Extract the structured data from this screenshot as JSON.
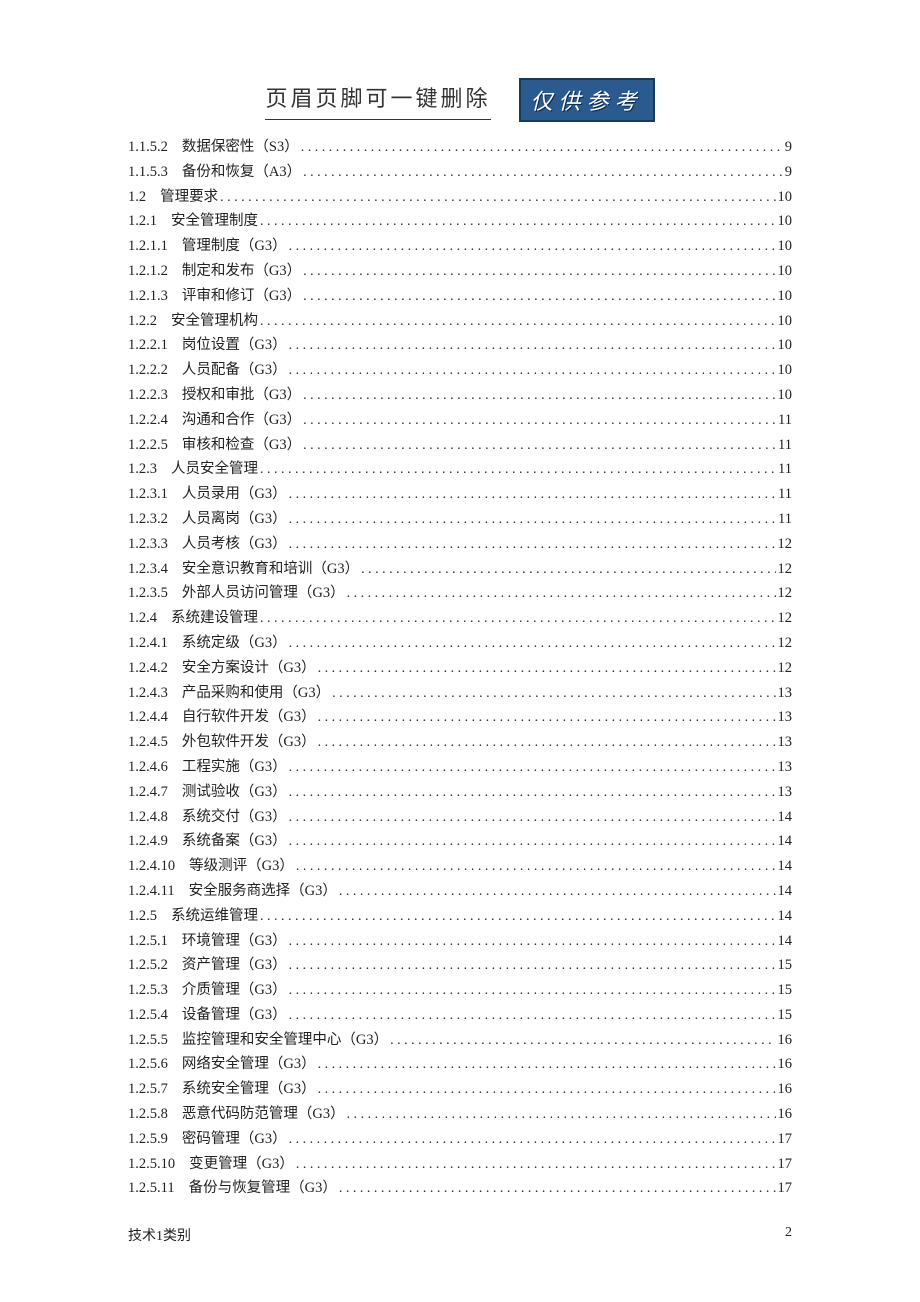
{
  "header": {
    "title": "页眉页脚可一键删除",
    "badge": "仅供参考"
  },
  "toc": [
    {
      "num": "1.1.5.2",
      "title": "数据保密性（S3）",
      "page": "9"
    },
    {
      "num": "1.1.5.3",
      "title": "备份和恢复（A3）",
      "page": "9"
    },
    {
      "num": "1.2",
      "title": "管理要求",
      "page": "10"
    },
    {
      "num": "1.2.1",
      "title": "安全管理制度",
      "page": "10"
    },
    {
      "num": "1.2.1.1",
      "title": "管理制度（G3）",
      "page": "10"
    },
    {
      "num": "1.2.1.2",
      "title": "制定和发布（G3）",
      "page": "10"
    },
    {
      "num": "1.2.1.3",
      "title": "评审和修订（G3）",
      "page": "10"
    },
    {
      "num": "1.2.2",
      "title": "安全管理机构",
      "page": "10"
    },
    {
      "num": "1.2.2.1",
      "title": "岗位设置（G3）",
      "page": "10"
    },
    {
      "num": "1.2.2.2",
      "title": "人员配备（G3）",
      "page": "10"
    },
    {
      "num": "1.2.2.3",
      "title": "授权和审批（G3）",
      "page": "10"
    },
    {
      "num": "1.2.2.4",
      "title": "沟通和合作（G3）",
      "page": "11"
    },
    {
      "num": "1.2.2.5",
      "title": "审核和检查（G3）",
      "page": "11"
    },
    {
      "num": "1.2.3",
      "title": "人员安全管理",
      "page": "11"
    },
    {
      "num": "1.2.3.1",
      "title": "人员录用（G3）",
      "page": "11"
    },
    {
      "num": "1.2.3.2",
      "title": "人员离岗（G3）",
      "page": "11"
    },
    {
      "num": "1.2.3.3",
      "title": "人员考核（G3）",
      "page": "12"
    },
    {
      "num": "1.2.3.4",
      "title": "安全意识教育和培训（G3）",
      "page": "12"
    },
    {
      "num": "1.2.3.5",
      "title": "外部人员访问管理（G3）",
      "page": "12"
    },
    {
      "num": "1.2.4",
      "title": "系统建设管理",
      "page": "12"
    },
    {
      "num": "1.2.4.1",
      "title": "系统定级（G3）",
      "page": "12"
    },
    {
      "num": "1.2.4.2",
      "title": "安全方案设计（G3）",
      "page": "12"
    },
    {
      "num": "1.2.4.3",
      "title": "产品采购和使用（G3）",
      "page": "13"
    },
    {
      "num": "1.2.4.4",
      "title": "自行软件开发（G3）",
      "page": "13"
    },
    {
      "num": "1.2.4.5",
      "title": "外包软件开发（G3）",
      "page": "13"
    },
    {
      "num": "1.2.4.6",
      "title": "工程实施（G3）",
      "page": "13"
    },
    {
      "num": "1.2.4.7",
      "title": "测试验收（G3）",
      "page": "13"
    },
    {
      "num": "1.2.4.8",
      "title": "系统交付（G3）",
      "page": "14"
    },
    {
      "num": "1.2.4.9",
      "title": "系统备案（G3）",
      "page": "14"
    },
    {
      "num": "1.2.4.10",
      "title": "等级测评（G3）",
      "page": "14"
    },
    {
      "num": "1.2.4.11",
      "title": "安全服务商选择（G3）",
      "page": "14"
    },
    {
      "num": "1.2.5",
      "title": "系统运维管理",
      "page": "14"
    },
    {
      "num": "1.2.5.1",
      "title": "环境管理（G3）",
      "page": "14"
    },
    {
      "num": "1.2.5.2",
      "title": "资产管理（G3）",
      "page": "15"
    },
    {
      "num": "1.2.5.3",
      "title": "介质管理（G3）",
      "page": "15"
    },
    {
      "num": "1.2.5.4",
      "title": "设备管理（G3）",
      "page": "15"
    },
    {
      "num": "1.2.5.5",
      "title": "监控管理和安全管理中心（G3）",
      "page": "16"
    },
    {
      "num": "1.2.5.6",
      "title": "网络安全管理（G3）",
      "page": "16"
    },
    {
      "num": "1.2.5.7",
      "title": "系统安全管理（G3）",
      "page": "16"
    },
    {
      "num": "1.2.5.8",
      "title": "恶意代码防范管理（G3）",
      "page": "16"
    },
    {
      "num": "1.2.5.9",
      "title": "密码管理（G3）",
      "page": "17"
    },
    {
      "num": "1.2.5.10",
      "title": "变更管理（G3）",
      "page": "17"
    },
    {
      "num": "1.2.5.11",
      "title": "备份与恢复管理（G3）",
      "page": "17"
    }
  ],
  "footer": {
    "left": "技术1类别",
    "right": "2"
  }
}
